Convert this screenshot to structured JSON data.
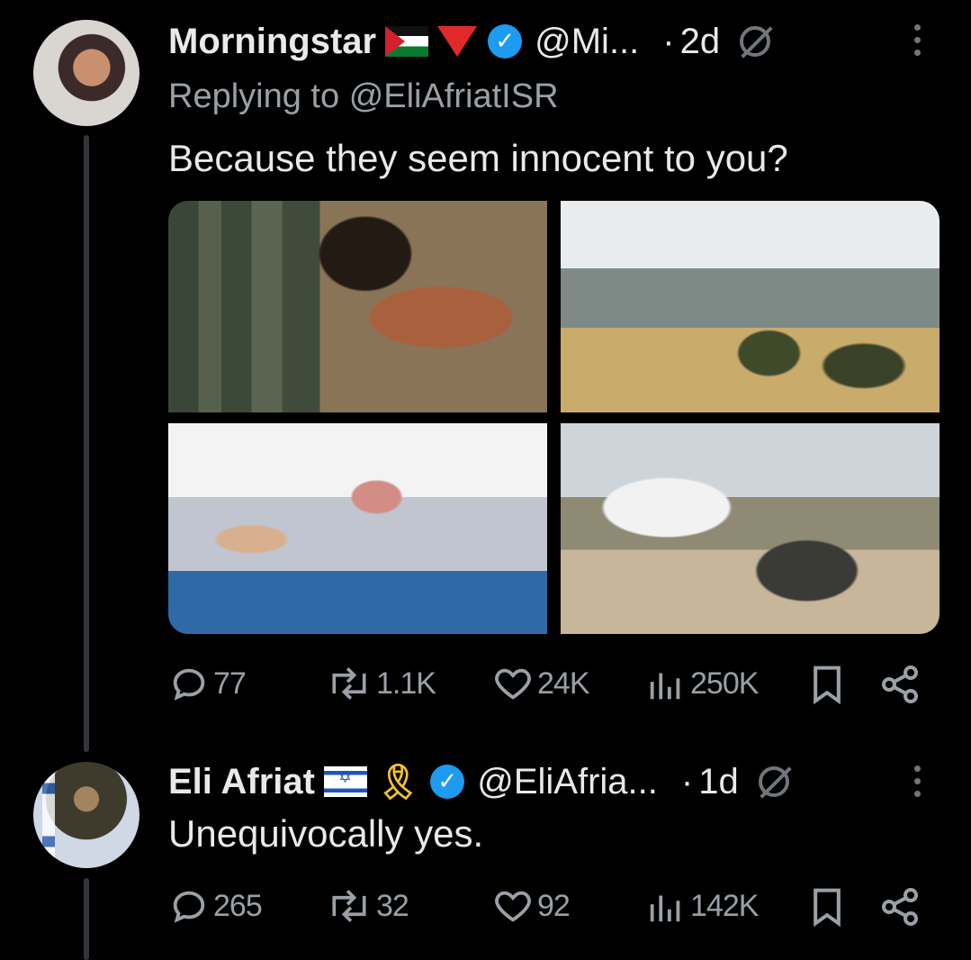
{
  "tweet1": {
    "name": "Morningstar",
    "flags": [
      "palestine-flag",
      "red-triangle"
    ],
    "handle": "@Mi...",
    "dot": "·",
    "time": "2d",
    "replying_prefix": "Replying to",
    "replying_to": "@EliAfriatISR",
    "text": "Because they seem innocent to you?",
    "media_count": 4,
    "stats": {
      "replies": "77",
      "reposts": "1.1K",
      "likes": "24K",
      "views": "250K"
    }
  },
  "tweet2": {
    "name": "Eli Afriat",
    "flags": [
      "israel-flag",
      "yellow-ribbon"
    ],
    "handle": "@EliAfria...",
    "dot": "·",
    "time": "1d",
    "text": "Unequivocally yes.",
    "stats": {
      "replies": "265",
      "reposts": "32",
      "likes": "92",
      "views": "142K"
    }
  },
  "colors": {
    "background": "#000000",
    "text": "#e7e9ea",
    "muted": "#71767b",
    "verified": "#1d9bf0"
  },
  "icons": [
    "reply-icon",
    "repost-icon",
    "like-icon",
    "views-icon",
    "bookmark-icon",
    "share-icon",
    "grok-icon",
    "more-icon",
    "verified-badge-icon"
  ]
}
